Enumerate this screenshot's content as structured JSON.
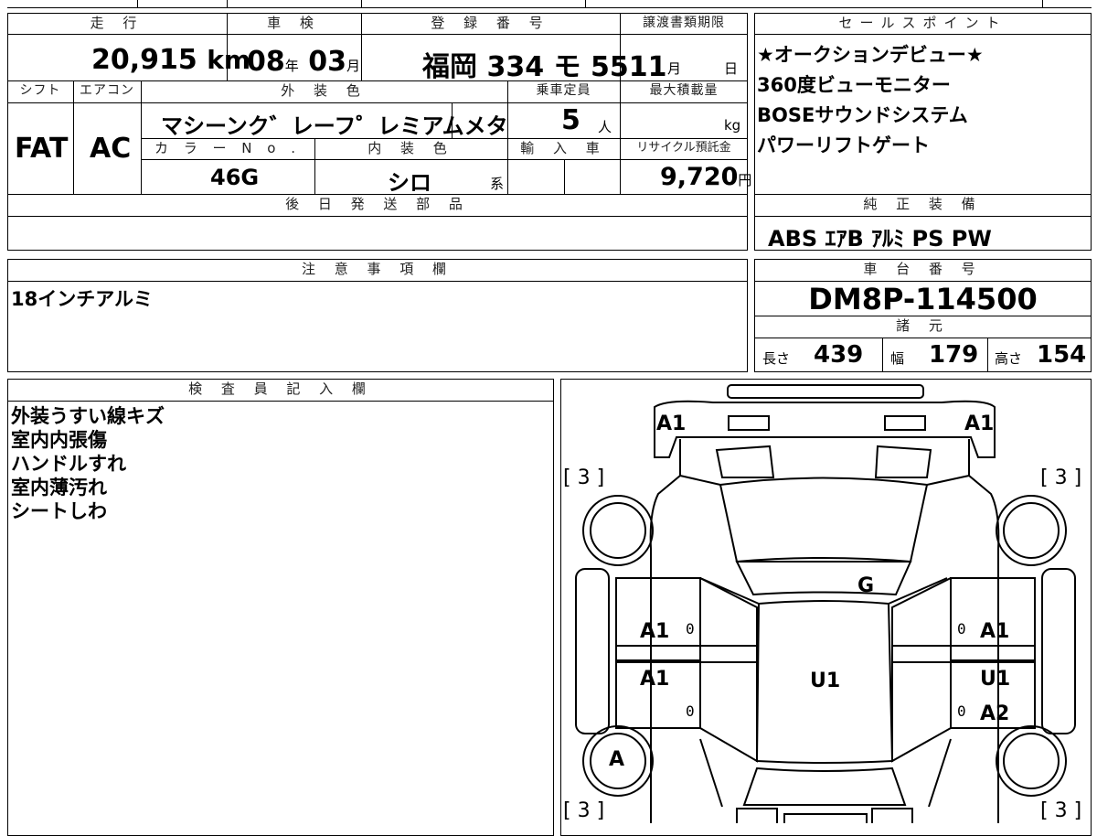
{
  "vehicle": {
    "mileage_label": "走 行",
    "mileage_value": "20,915",
    "mileage_unit": "km",
    "shaken_label": "車 検",
    "shaken_year": "08",
    "shaken_year_unit": "年",
    "shaken_month": "03",
    "shaken_month_unit": "月",
    "reg_label": "登 録 番 号",
    "reg_value": "福岡  334 モ 5511",
    "transfer_label": "譲渡書類期限",
    "transfer_month_unit": "月",
    "transfer_day_unit": "日",
    "shift_label": "シフト",
    "shift_value": "FAT",
    "ac_label": "エアコン",
    "ac_value": "AC",
    "ext_color_label": "外 装 色",
    "ext_color_value": "マシーンク゛レーフ゜レミアムメタ",
    "capacity_label": "乗車定員",
    "capacity_value": "5",
    "capacity_unit": "人",
    "maxload_label": "最大積載量",
    "maxload_unit": "kg",
    "color_no_label": "カ ラ ー N o .",
    "color_no_value": "46G",
    "int_color_label": "内 装 色",
    "int_color_value": "シロ",
    "int_color_suffix": "系",
    "import_label": "輸 入 車",
    "recycle_label": "リサイクル預託金",
    "recycle_value": "9,720",
    "recycle_unit": "円",
    "later_parts_label": "後 日 発 送 部 品"
  },
  "sales_points": {
    "label": "セールスポイント",
    "items": [
      "★オークションデビュー★",
      "360度ビューモニター",
      "BOSEサウンドシステム",
      "パワーリフトゲート"
    ]
  },
  "equipment": {
    "label": "純 正 装 備",
    "value": "ABS  ｴｱB  ｱﾙﾐ  PS  PW"
  },
  "notes": {
    "label": "注 意 事 項 欄",
    "value": "18インチアルミ"
  },
  "chassis": {
    "label": "車 台 番 号",
    "value": "DM8P-114500"
  },
  "specs": {
    "label": "諸 元",
    "length_label": "長さ",
    "length_value": "439",
    "width_label": "幅",
    "width_value": "179",
    "height_label": "高さ",
    "height_value": "154"
  },
  "inspector": {
    "label": "検 査 員 記 入 欄",
    "lines": [
      "外装うすい線キズ",
      "室内内張傷",
      "ハンドルすれ",
      "室内薄汚れ",
      "シートしわ"
    ]
  },
  "diagram": {
    "labels": {
      "front_left": "A1",
      "front_right": "A1",
      "tire_fl": "[ 3 ]",
      "tire_fr": "[ 3 ]",
      "tire_rl": "[ 3 ]",
      "tire_rr": "[ 3 ]",
      "glass": "G",
      "door_fl": "A1",
      "door_fr": "A1",
      "door_rl": "A1",
      "door_rr_top": "U1",
      "door_rr_bottom": "A2",
      "roof": "U1",
      "wheel_rl": "A",
      "zero": "0"
    }
  }
}
